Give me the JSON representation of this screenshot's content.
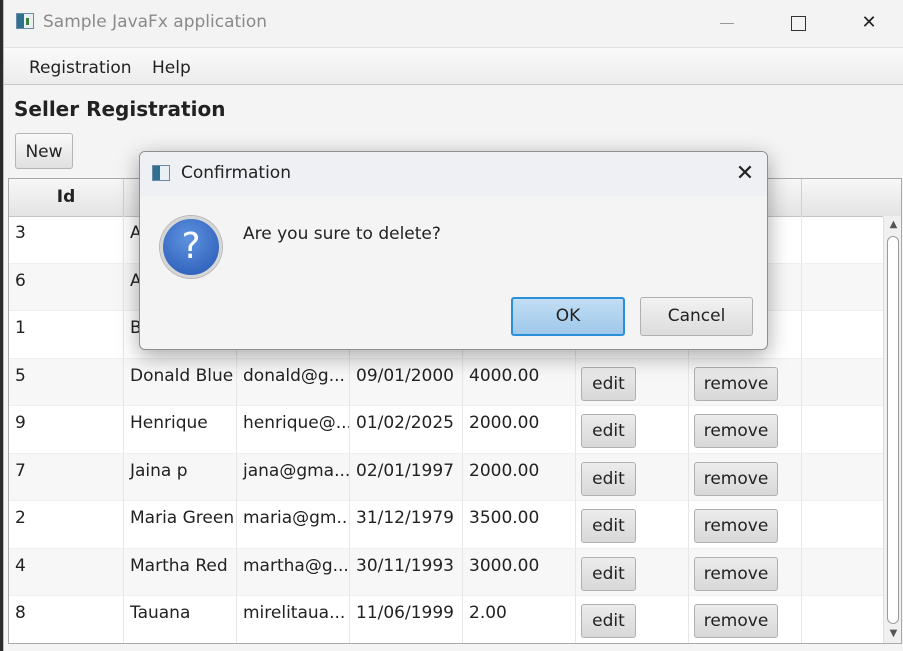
{
  "window": {
    "title": "Sample JavaFx application",
    "minimize_icon": "minimize-icon",
    "maximize_icon": "maximize-icon",
    "close_glyph": "✕"
  },
  "menu": {
    "items": [
      {
        "label": "Registration"
      },
      {
        "label": "Help"
      }
    ]
  },
  "page": {
    "title": "Seller Registration",
    "new_button": "New"
  },
  "table": {
    "columns": [
      "Id",
      "",
      "",
      "",
      "",
      "",
      "",
      ""
    ],
    "rows": [
      {
        "id": "3",
        "name": "Al",
        "email": "",
        "birth": "",
        "salary": "",
        "edit": "",
        "remove": ""
      },
      {
        "id": "6",
        "name": "Al",
        "email": "",
        "birth": "",
        "salary": "",
        "edit": "",
        "remove": ""
      },
      {
        "id": "1",
        "name": "Bo",
        "email": "",
        "birth": "",
        "salary": "",
        "edit": "",
        "remove": ""
      },
      {
        "id": "5",
        "name": "Donald Blue",
        "email": "donald@g...",
        "birth": "09/01/2000",
        "salary": "4000.00",
        "edit": "edit",
        "remove": "remove"
      },
      {
        "id": "9",
        "name": "Henrique",
        "email": "henrique@...",
        "birth": "01/02/2025",
        "salary": "2000.00",
        "edit": "edit",
        "remove": "remove"
      },
      {
        "id": "7",
        "name": "Jaina p",
        "email": "jana@gma...",
        "birth": "02/01/1997",
        "salary": "2000.00",
        "edit": "edit",
        "remove": "remove"
      },
      {
        "id": "2",
        "name": "Maria Green",
        "email": "maria@gm...",
        "birth": "31/12/1979",
        "salary": "3500.00",
        "edit": "edit",
        "remove": "remove"
      },
      {
        "id": "4",
        "name": "Martha Red",
        "email": "martha@g...",
        "birth": "30/11/1993",
        "salary": "3000.00",
        "edit": "edit",
        "remove": "remove"
      },
      {
        "id": "8",
        "name": "Tauana",
        "email": "mirelitaua...",
        "birth": "11/06/1999",
        "salary": "2.00",
        "edit": "edit",
        "remove": "remove"
      }
    ]
  },
  "dialog": {
    "title": "Confirmation",
    "close_glyph": "✕",
    "icon_glyph": "?",
    "message": "Are you sure to delete?",
    "ok_label": "OK",
    "cancel_label": "Cancel"
  }
}
